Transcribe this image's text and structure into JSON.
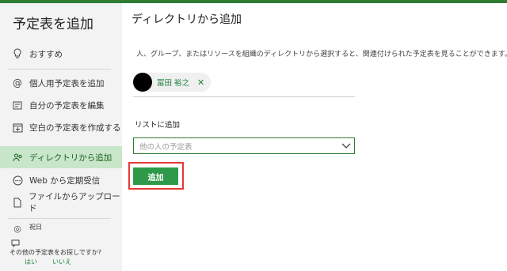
{
  "sidebar": {
    "title": "予定表を追加",
    "items": [
      {
        "label": "おすすめ",
        "icon": "lightbulb-icon"
      },
      {
        "label": "個人用予定表を追加",
        "icon": "at-icon"
      },
      {
        "label": "自分の予定表を編集",
        "icon": "edit-calendar-icon"
      },
      {
        "label": "空白の予定表を作成する",
        "icon": "calendar-plus-icon"
      },
      {
        "label": "ディレクトリから追加",
        "icon": "people-icon"
      },
      {
        "label": "Web から定期受信",
        "icon": "more-icon"
      },
      {
        "label": "ファイルからアップロード",
        "icon": "file-upload-icon"
      },
      {
        "label": "祝日",
        "icon": "globe-icon"
      }
    ],
    "feedback": {
      "question": "その他の予定表をお探しですか?",
      "yes": "はい",
      "no": "いいえ"
    }
  },
  "main": {
    "title": "ディレクトリから追加",
    "description": "人、グループ、またはリソースを組織のディレクトリから選択すると、関連付けられた予定表を見ることができます。",
    "chip_name": "冨田 裕之",
    "add_to_list_label": "リストに追加",
    "select_placeholder": "他の人の予定表",
    "add_button": "追加"
  },
  "colors": {
    "accent": "#2e9a49",
    "highlight": "#e53935",
    "active_bg": "#c8e6c9"
  }
}
